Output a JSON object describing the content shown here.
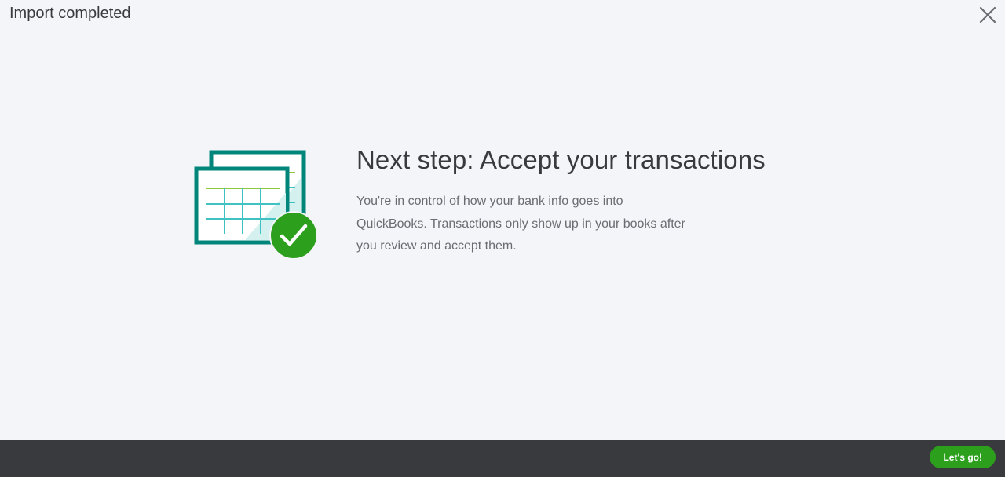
{
  "dialog": {
    "title": "Import completed",
    "close_icon": "close-icon"
  },
  "main": {
    "illustration_icon": "spreadsheet-check-icon",
    "headline": "Next step: Accept your transactions",
    "body": "You're in control of how your bank info goes into QuickBooks. Transactions only show up in your books after you review and accept them."
  },
  "footer": {
    "primary_button_label": "Let's go!"
  },
  "colors": {
    "background": "#f4f5f8",
    "footer": "#393a3d",
    "primary": "#2ca01c",
    "teal": "#00857a",
    "text": "#393a3d",
    "muted_text": "#6b6c72"
  }
}
